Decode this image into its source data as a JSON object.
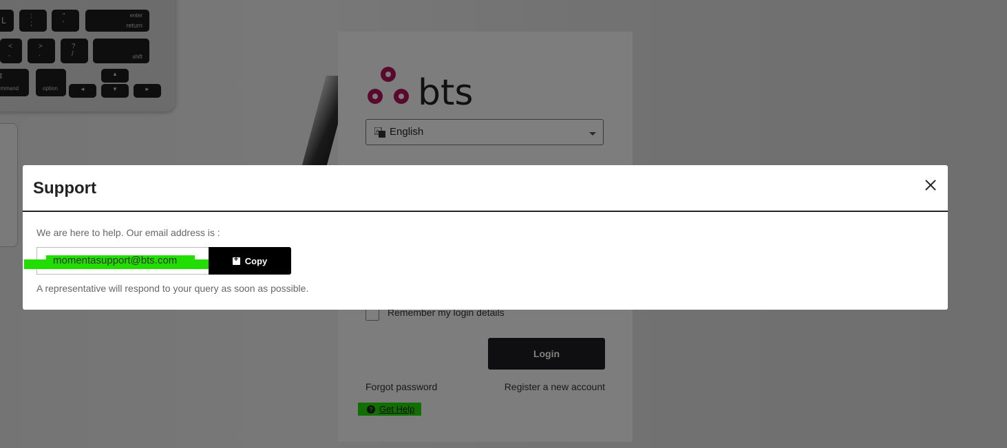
{
  "login": {
    "brand": "bts",
    "language": "English",
    "remember_label": "Remember my login details",
    "login_label": "Login",
    "forgot_label": "Forgot password",
    "register_label": "Register a new account",
    "get_help_label": "Get Help"
  },
  "modal": {
    "title": "Support",
    "help_text": "We are here to help. Our email address is :",
    "email": "momentasupport@bts.com",
    "copy_label": "Copy",
    "rep_text": "A representative will respond to your query as soon as possible."
  },
  "colors": {
    "brand": "#b3125a",
    "highlight": "#22dd00",
    "button": "#1e1e22"
  },
  "icons": [
    "translate-icon",
    "chevron-down-icon",
    "question-circle-icon",
    "close-icon",
    "copy-icon"
  ]
}
